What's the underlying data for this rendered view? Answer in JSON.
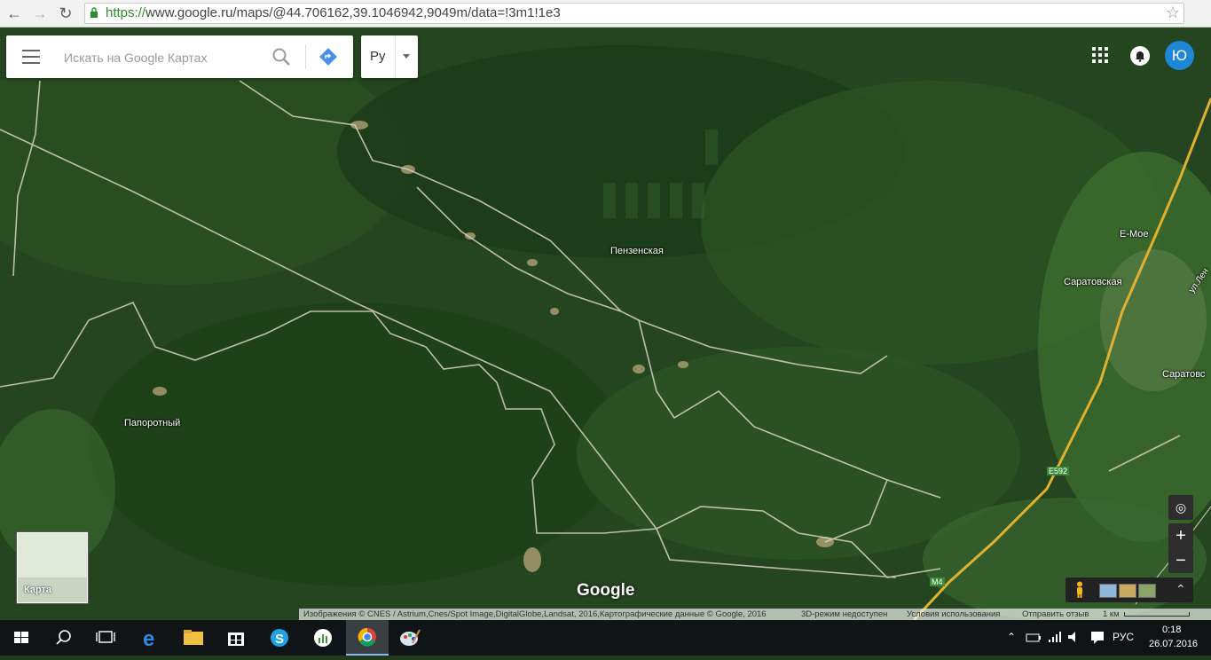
{
  "browser": {
    "url_scheme": "https://",
    "url_rest": "www.google.ru/maps/@44.706162,39.1046942,9049m/data=!3m1!1e3",
    "back_icon": "back-arrow-icon",
    "forward_icon": "forward-arrow-icon",
    "reload_icon": "reload-icon",
    "bookmark_icon": "star-icon"
  },
  "search": {
    "placeholder": "Искать на Google Картах",
    "lang_label": "Ру"
  },
  "account": {
    "avatar_letter": "Ю"
  },
  "map": {
    "labels": {
      "penzenskaya": "Пензенская",
      "paporotny": "Папоротный",
      "saratovskaya": "Саратовская",
      "saratovs_edge": "Саратовс",
      "emoe": "Е-Мое",
      "ul_len": "ул.Лен",
      "e592": "E592",
      "m4": "M4"
    },
    "minimap_label": "Карта",
    "logo": "Google",
    "zoom_in": "+",
    "zoom_out": "−"
  },
  "attribution": {
    "imagery": "Изображения © CNES / Astrium,Cnes/Spot Image,DigitalGlobe,Landsat, 2016,Картографические данные © Google, 2016",
    "three_d": "3D-режим недоступен",
    "terms": "Условия использования",
    "feedback": "Отправить отзыв",
    "scale": "1 км"
  },
  "taskbar": {
    "lang": "РУС",
    "time": "0:18",
    "date": "26.07.2016"
  },
  "colors": {
    "forest": "#24451f",
    "road": "#d9d4c4",
    "highway": "#e0b030",
    "accent": "#1e88d6"
  }
}
